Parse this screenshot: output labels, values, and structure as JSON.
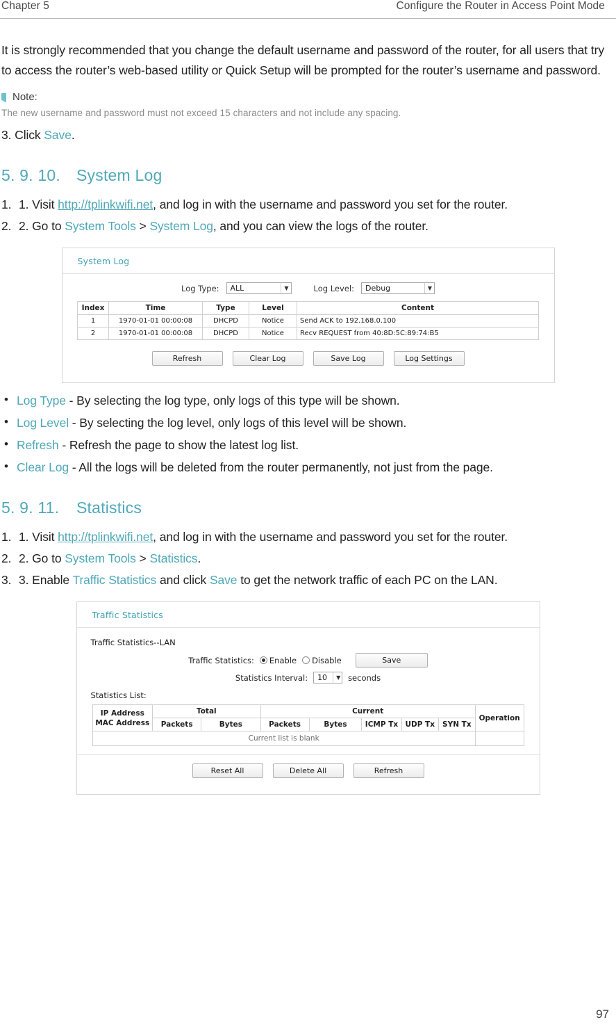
{
  "header": {
    "chapter": "Chapter 5",
    "title": "Configure the Router in Access Point Mode"
  },
  "intro": {
    "paragraph": "It is strongly recommended that you change the default username and password of the router, for all users that try to access the router’s web-based utility or Quick Setup will be prompted for the router’s username and password.",
    "note_label": "Note:",
    "note_text": "The new username and password must not exceed 15 characters and not include any spacing.",
    "step3_prefix": "3. Click ",
    "step3_link": "Save",
    "step3_suffix": "."
  },
  "system_log_section": {
    "number": "5. 9. 10.",
    "title": "System Log",
    "step1_prefix": "1. Visit ",
    "step1_link": "http://tplinkwifi.net",
    "step1_suffix": ", and log in with the username and password you set for the router.",
    "step2_prefix": "2. Go to ",
    "step2_link1": "System Tools",
    "step2_mid": " > ",
    "step2_link2": "System Log",
    "step2_suffix": ", and you can view the logs of the router.",
    "bullets": [
      {
        "term": "Log Type",
        "desc": " - By selecting the log type, only logs of this type will be shown."
      },
      {
        "term": "Log Level",
        "desc": " - By selecting the log level, only logs of this level will be shown."
      },
      {
        "term": "Refresh",
        "desc": " - Refresh the page to show the latest log list."
      },
      {
        "term": "Clear Log",
        "desc": " - All the logs will be deleted from the router permanently, not just from the page."
      }
    ]
  },
  "system_log_shot": {
    "panel_title": "System Log",
    "log_type_label": "Log Type:",
    "log_type_value": "ALL",
    "log_level_label": "Log Level:",
    "log_level_value": "Debug",
    "columns": [
      "Index",
      "Time",
      "Type",
      "Level",
      "Content"
    ],
    "rows": [
      [
        "1",
        "1970-01-01 00:00:08",
        "DHCPD",
        "Notice",
        "Send ACK to 192.168.0.100"
      ],
      [
        "2",
        "1970-01-01 00:00:08",
        "DHCPD",
        "Notice",
        "Recv REQUEST from 40:8D:5C:89:74:B5"
      ]
    ],
    "buttons": [
      "Refresh",
      "Clear Log",
      "Save Log",
      "Log Settings"
    ]
  },
  "statistics_section": {
    "number": "5. 9. 11.",
    "title": "Statistics",
    "step1_prefix": "1. Visit ",
    "step1_link": "http://tplinkwifi.net",
    "step1_suffix": ", and log in with the username and password you set for the router.",
    "step2_prefix": "2. Go to ",
    "step2_link1": "System Tools",
    "step2_mid": " > ",
    "step2_link2": "Statistics",
    "step2_suffix": ".",
    "step3_prefix": "3. Enable ",
    "step3_link1": "Traffic Statistics",
    "step3_mid": " and click ",
    "step3_link2": "Save",
    "step3_suffix": " to get the network traffic of each PC on the LAN."
  },
  "traffic_stats_shot": {
    "panel_title": "Traffic Statistics",
    "section_label": "Traffic Statistics--LAN",
    "traffic_label": "Traffic Statistics:",
    "enable_label": "Enable",
    "disable_label": "Disable",
    "save_button": "Save",
    "interval_label": "Statistics Interval:",
    "interval_value": "10",
    "interval_unit": "seconds",
    "list_label": "Statistics List:",
    "group_total": "Total",
    "group_current": "Current",
    "col_ip_mac": "IP Address\nMAC Address",
    "col_ip": "IP Address",
    "col_mac": "MAC Address",
    "col_packets": "Packets",
    "col_bytes": "Bytes",
    "col_icmp": "ICMP Tx",
    "col_udp": "UDP Tx",
    "col_syn": "SYN Tx",
    "col_operation": "Operation",
    "blank_text": "Current list is blank",
    "buttons": [
      "Reset All",
      "Delete All",
      "Refresh"
    ]
  },
  "page_number": "97"
}
